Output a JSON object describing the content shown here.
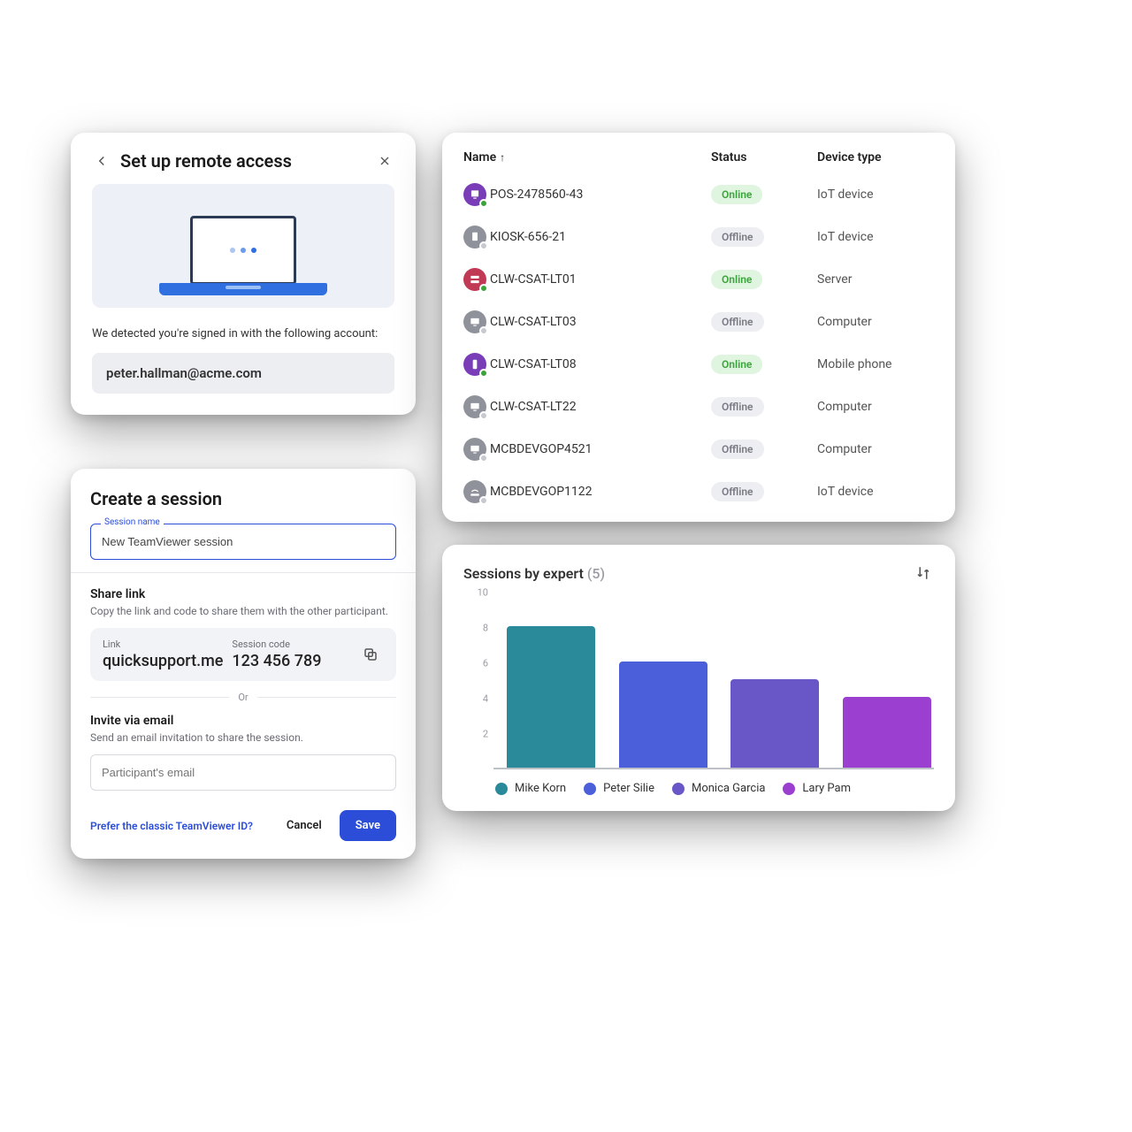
{
  "setup": {
    "title": "Set up remote access",
    "detected_text": "We detected you're signed in with the following account:",
    "email": "peter.hallman@acme.com"
  },
  "session": {
    "title": "Create a session",
    "name_label": "Session name",
    "name_value": "New TeamViewer session",
    "share_heading": "Share link",
    "share_sub": "Copy the link and code to share them with the other participant.",
    "link_label": "Link",
    "link_value": "quicksupport.me",
    "code_label": "Session code",
    "code_value": "123 456 789",
    "or_label": "Or",
    "invite_heading": "Invite via email",
    "invite_sub": "Send an email invitation to share the session.",
    "email_placeholder": "Participant's email",
    "prefer_link": "Prefer the classic TeamViewer ID?",
    "cancel": "Cancel",
    "save": "Save"
  },
  "devices": {
    "columns": {
      "name": "Name",
      "status": "Status",
      "type": "Device type"
    },
    "rows": [
      {
        "name": "POS-2478560-43",
        "status": "Online",
        "type": "IoT device",
        "icon": "pos",
        "icon_color": "purple"
      },
      {
        "name": "KIOSK-656-21",
        "status": "Offline",
        "type": "IoT device",
        "icon": "kiosk",
        "icon_color": "gray"
      },
      {
        "name": "CLW-CSAT-LT01",
        "status": "Online",
        "type": "Server",
        "icon": "server",
        "icon_color": "red"
      },
      {
        "name": "CLW-CSAT-LT03",
        "status": "Offline",
        "type": "Computer",
        "icon": "computer",
        "icon_color": "gray"
      },
      {
        "name": "CLW-CSAT-LT08",
        "status": "Online",
        "type": "Mobile phone",
        "icon": "mobile",
        "icon_color": "purple"
      },
      {
        "name": "CLW-CSAT-LT22",
        "status": "Offline",
        "type": "Computer",
        "icon": "computer",
        "icon_color": "gray"
      },
      {
        "name": "MCBDEVGOP4521",
        "status": "Offline",
        "type": "Computer",
        "icon": "computer",
        "icon_color": "gray"
      },
      {
        "name": "MCBDEVGOP1122",
        "status": "Offline",
        "type": "IoT device",
        "icon": "router",
        "icon_color": "gray"
      }
    ]
  },
  "chart": {
    "title": "Sessions by expert",
    "count_suffix": "(5)"
  },
  "chart_data": {
    "type": "bar",
    "title": "Sessions by expert (5)",
    "xlabel": "",
    "ylabel": "",
    "ylim": [
      0,
      10
    ],
    "yticks": [
      2,
      4,
      6,
      8,
      10
    ],
    "categories": [
      "Mike Korn",
      "Peter Silie",
      "Monica Garcia",
      "Lary Pam"
    ],
    "values": [
      8,
      6,
      5,
      4
    ],
    "colors": [
      "#2a8a99",
      "#4a5fd9",
      "#6a57c7",
      "#9b3fd1"
    ]
  }
}
